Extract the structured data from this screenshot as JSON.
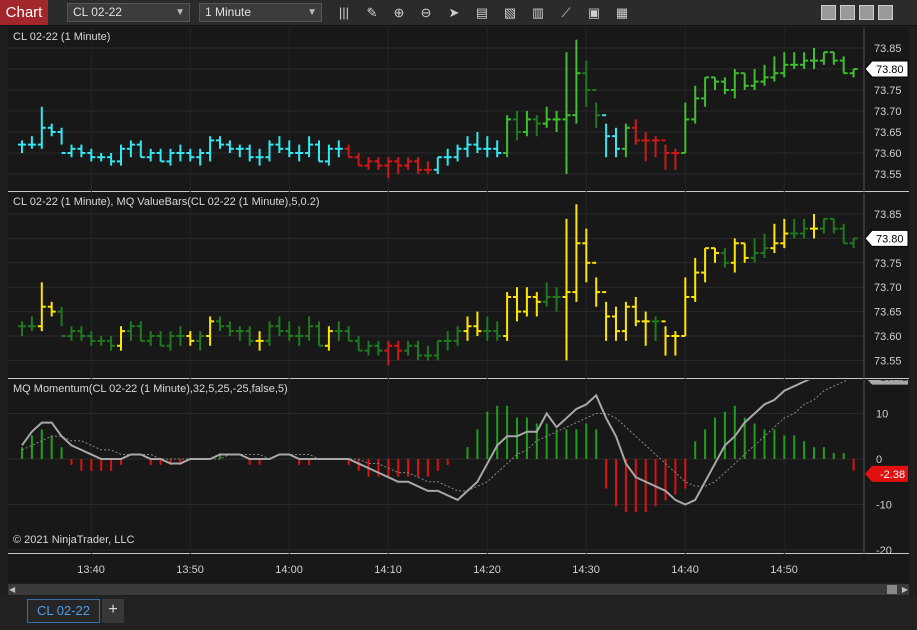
{
  "toolbar": {
    "chart_label": "Chart",
    "instrument": "CL 02-22",
    "interval": "1 Minute",
    "icons": [
      "bar-type-icon",
      "pencil-icon",
      "zoom-in-icon",
      "zoom-out-icon",
      "pointer-icon",
      "data-box-icon",
      "properties-icon",
      "indicators-icon",
      "strategies-icon",
      "chart-trader-icon",
      "templates-icon"
    ]
  },
  "panes": {
    "price": {
      "title": "CL 02-22 (1 Minute)",
      "ticks": [
        "73.85",
        "73.80",
        "73.75",
        "73.70",
        "73.65",
        "73.60",
        "73.55"
      ],
      "last_price": "73.80"
    },
    "valuebars": {
      "title": "CL 02-22 (1 Minute), MQ ValueBars(CL 02-22 (1 Minute),5,0.2)",
      "ticks": [
        "73.85",
        "73.80",
        "73.75",
        "73.70",
        "73.65",
        "73.60",
        "73.55"
      ],
      "last_price": "73.80"
    },
    "momentum": {
      "title": "MQ Momentum(CL 02-22 (1 Minute),32,5,25,-25,false,5)",
      "ticks": [
        "10",
        "0",
        "-10",
        "-20"
      ],
      "upper_level": "25",
      "lower_level": "-25",
      "line_value": "19.41",
      "histogram_value": "-2.38",
      "copyright": "© 2021 NinjaTrader, LLC"
    }
  },
  "time_axis": [
    "13:40",
    "13:50",
    "14:00",
    "14:10",
    "14:20",
    "14:30",
    "14:40",
    "14:50"
  ],
  "tabs": [
    {
      "label": "CL 02-22"
    }
  ],
  "add_tab_label": "+",
  "colors": {
    "up_cyan": "#33e8f2",
    "down_red": "#d01818",
    "green_light": "#3fbf2f",
    "green_dark": "#1f7a1f",
    "yellow": "#ffe600",
    "level_green": "#1ea01e",
    "level_red": "#e01010",
    "momentum_line": "#a8a8a8"
  },
  "chart_data": [
    {
      "type": "ohlc",
      "title": "CL 02-22 (1 Minute)",
      "x": [
        "13:33",
        "13:34",
        "13:35",
        "13:36",
        "13:37",
        "13:38",
        "13:39",
        "13:40",
        "13:41",
        "13:42",
        "13:43",
        "13:44",
        "13:45",
        "13:46",
        "13:47",
        "13:48",
        "13:49",
        "13:50",
        "13:51",
        "13:52",
        "13:53",
        "13:54",
        "13:55",
        "13:56",
        "13:57",
        "13:58",
        "13:59",
        "14:00",
        "14:01",
        "14:02",
        "14:03",
        "14:04",
        "14:05",
        "14:06",
        "14:07",
        "14:08",
        "14:09",
        "14:10",
        "14:11",
        "14:12",
        "14:13",
        "14:14",
        "14:15",
        "14:16",
        "14:17",
        "14:18",
        "14:19",
        "14:20",
        "14:21",
        "14:22",
        "14:23",
        "14:24",
        "14:25",
        "14:26",
        "14:27",
        "14:28",
        "14:29",
        "14:30",
        "14:31",
        "14:32",
        "14:33",
        "14:34",
        "14:35",
        "14:36",
        "14:37",
        "14:38",
        "14:39",
        "14:40",
        "14:41",
        "14:42",
        "14:43",
        "14:44",
        "14:45",
        "14:46",
        "14:47",
        "14:48",
        "14:49",
        "14:50",
        "14:51",
        "14:52",
        "14:53",
        "14:54",
        "14:55",
        "14:56",
        "14:57"
      ],
      "open": [
        73.62,
        73.62,
        73.62,
        73.66,
        73.65,
        73.6,
        73.61,
        73.6,
        73.59,
        73.59,
        73.58,
        73.61,
        73.62,
        73.59,
        73.6,
        73.58,
        73.6,
        73.6,
        73.59,
        73.6,
        73.63,
        73.62,
        73.61,
        73.61,
        73.59,
        73.59,
        73.62,
        73.61,
        73.6,
        73.6,
        73.62,
        73.58,
        73.61,
        73.61,
        73.59,
        73.57,
        73.58,
        73.57,
        73.58,
        73.57,
        73.58,
        73.56,
        73.56,
        73.59,
        73.59,
        73.61,
        73.62,
        73.61,
        73.61,
        73.6,
        73.68,
        73.65,
        73.68,
        73.67,
        73.68,
        73.68,
        73.69,
        73.79,
        73.75,
        73.69,
        73.64,
        73.61,
        73.66,
        73.63,
        73.63,
        73.63,
        73.6,
        73.6,
        73.68,
        73.73,
        73.78,
        73.77,
        73.75,
        73.79,
        73.76,
        73.77,
        73.78,
        73.79,
        73.81,
        73.81,
        73.82,
        73.82,
        73.84,
        73.82,
        73.79
      ],
      "high": [
        73.63,
        73.64,
        73.71,
        73.67,
        73.66,
        73.62,
        73.62,
        73.61,
        73.6,
        73.6,
        73.62,
        73.63,
        73.63,
        73.61,
        73.61,
        73.61,
        73.62,
        73.61,
        73.61,
        73.64,
        73.64,
        73.63,
        73.62,
        73.62,
        73.61,
        73.63,
        73.64,
        73.63,
        73.62,
        73.64,
        73.63,
        73.62,
        73.63,
        73.62,
        73.6,
        73.59,
        73.59,
        73.59,
        73.59,
        73.59,
        73.59,
        73.58,
        73.59,
        73.61,
        73.62,
        73.64,
        73.65,
        73.64,
        73.63,
        73.69,
        73.7,
        73.7,
        73.69,
        73.71,
        73.7,
        73.84,
        73.87,
        73.82,
        73.72,
        73.67,
        73.66,
        73.67,
        73.68,
        73.65,
        73.64,
        73.62,
        73.61,
        73.72,
        73.76,
        73.78,
        73.78,
        73.78,
        73.8,
        73.79,
        73.8,
        73.81,
        73.83,
        73.84,
        73.84,
        73.84,
        73.85,
        73.84,
        73.84,
        73.83,
        73.8
      ],
      "low": [
        73.6,
        73.61,
        73.61,
        73.64,
        73.62,
        73.59,
        73.59,
        73.58,
        73.58,
        73.57,
        73.57,
        73.59,
        73.59,
        73.58,
        73.58,
        73.57,
        73.58,
        73.58,
        73.57,
        73.58,
        73.61,
        73.6,
        73.59,
        73.58,
        73.57,
        73.58,
        73.6,
        73.59,
        73.58,
        73.59,
        73.58,
        73.57,
        73.59,
        73.59,
        73.57,
        73.56,
        73.56,
        73.54,
        73.55,
        73.56,
        73.55,
        73.55,
        73.55,
        73.57,
        73.58,
        73.59,
        73.6,
        73.59,
        73.59,
        73.59,
        73.63,
        73.64,
        73.64,
        73.66,
        73.65,
        73.55,
        73.67,
        73.71,
        73.66,
        73.59,
        73.59,
        73.59,
        73.62,
        73.58,
        73.59,
        73.56,
        73.56,
        73.6,
        73.67,
        73.71,
        73.75,
        73.74,
        73.73,
        73.75,
        73.75,
        73.76,
        73.77,
        73.78,
        73.8,
        73.8,
        73.8,
        73.81,
        73.81,
        73.79,
        73.78
      ],
      "close": [
        73.62,
        73.62,
        73.66,
        73.65,
        73.6,
        73.61,
        73.6,
        73.59,
        73.59,
        73.58,
        73.61,
        73.62,
        73.59,
        73.6,
        73.58,
        73.6,
        73.6,
        73.59,
        73.6,
        73.63,
        73.62,
        73.61,
        73.61,
        73.59,
        73.59,
        73.62,
        73.61,
        73.6,
        73.6,
        73.62,
        73.58,
        73.61,
        73.61,
        73.59,
        73.57,
        73.58,
        73.57,
        73.58,
        73.57,
        73.58,
        73.56,
        73.56,
        73.59,
        73.59,
        73.61,
        73.62,
        73.61,
        73.61,
        73.6,
        73.68,
        73.65,
        73.68,
        73.67,
        73.68,
        73.68,
        73.69,
        73.79,
        73.75,
        73.69,
        73.64,
        73.61,
        73.66,
        73.63,
        73.63,
        73.63,
        73.6,
        73.6,
        73.68,
        73.73,
        73.78,
        73.77,
        73.75,
        73.79,
        73.76,
        73.77,
        73.78,
        73.79,
        73.81,
        73.81,
        73.82,
        73.82,
        73.84,
        73.82,
        73.79,
        73.8
      ]
    },
    {
      "type": "line+histogram",
      "title": "MQ Momentum(CL 02-22 (1 Minute),32,5,25,-25,false,5)",
      "x": [
        "13:33",
        "13:34",
        "13:35",
        "13:36",
        "13:37",
        "13:38",
        "13:39",
        "13:40",
        "13:41",
        "13:42",
        "13:43",
        "13:44",
        "13:45",
        "13:46",
        "13:47",
        "13:48",
        "13:49",
        "13:50",
        "13:51",
        "13:52",
        "13:53",
        "13:54",
        "13:55",
        "13:56",
        "13:57",
        "13:58",
        "13:59",
        "14:00",
        "14:01",
        "14:02",
        "14:03",
        "14:04",
        "14:05",
        "14:06",
        "14:07",
        "14:08",
        "14:09",
        "14:10",
        "14:11",
        "14:12",
        "14:13",
        "14:14",
        "14:15",
        "14:16",
        "14:17",
        "14:18",
        "14:19",
        "14:20",
        "14:21",
        "14:22",
        "14:23",
        "14:24",
        "14:25",
        "14:26",
        "14:27",
        "14:28",
        "14:29",
        "14:30",
        "14:31",
        "14:32",
        "14:33",
        "14:34",
        "14:35",
        "14:36",
        "14:37",
        "14:38",
        "14:39",
        "14:40",
        "14:41",
        "14:42",
        "14:43",
        "14:44",
        "14:45",
        "14:46",
        "14:47",
        "14:48",
        "14:49",
        "14:50",
        "14:51",
        "14:52",
        "14:53",
        "14:54",
        "14:55",
        "14:56",
        "14:57"
      ],
      "momentum": [
        3,
        6,
        8,
        8,
        5,
        3,
        2,
        1,
        0,
        0,
        0,
        1,
        1,
        0,
        0,
        -1,
        -1,
        0,
        0,
        0,
        1,
        1,
        1,
        0,
        0,
        0,
        1,
        1,
        0,
        0,
        0,
        0,
        0,
        0,
        -1,
        -2,
        -3,
        -4,
        -5,
        -5,
        -6,
        -7,
        -7,
        -8,
        -9,
        -7,
        -5,
        -1,
        3,
        5,
        5,
        6,
        6,
        10,
        7,
        9,
        11,
        12,
        14,
        9,
        5,
        -1,
        -4,
        -5,
        -6,
        -7,
        -9,
        -10,
        -9,
        -5,
        -1,
        3,
        5,
        8,
        10,
        12,
        13,
        15,
        16,
        17,
        18,
        19,
        21,
        21,
        19
      ],
      "signal": [
        2,
        3,
        4,
        5,
        5,
        4,
        4,
        3,
        2,
        2,
        1,
        1,
        1,
        1,
        0,
        0,
        0,
        0,
        0,
        0,
        0,
        1,
        1,
        1,
        1,
        0,
        1,
        1,
        1,
        1,
        0,
        0,
        0,
        0,
        0,
        -1,
        -1,
        -2,
        -3,
        -3,
        -4,
        -5,
        -5,
        -6,
        -7,
        -7,
        -6,
        -5,
        -3,
        -1,
        1,
        2,
        4,
        5,
        6,
        7,
        8,
        9,
        10,
        10,
        9,
        7,
        5,
        3,
        1,
        -1,
        -3,
        -5,
        -6,
        -6,
        -5,
        -3,
        -1,
        1,
        3,
        5,
        7,
        9,
        10,
        12,
        13,
        15,
        16,
        17,
        18
      ],
      "histogram": [
        2,
        4,
        5,
        4,
        2,
        -1,
        -2,
        -2,
        -2,
        -2,
        -1,
        0,
        0,
        -1,
        -1,
        -1,
        -1,
        0,
        0,
        0,
        1,
        0,
        0,
        -1,
        -1,
        0,
        0,
        0,
        -1,
        -1,
        0,
        0,
        0,
        -1,
        -2,
        -3,
        -3,
        -3,
        -3,
        -3,
        -3,
        -3,
        -2,
        -1,
        0,
        2,
        5,
        8,
        9,
        9,
        7,
        7,
        6,
        6,
        5,
        5,
        5,
        6,
        5,
        -5,
        -8,
        -9,
        -9,
        -9,
        -8,
        -7,
        -6,
        -5,
        3,
        5,
        7,
        8,
        9,
        7,
        6,
        5,
        5,
        4,
        4,
        3,
        2,
        2,
        1,
        1,
        -2
      ],
      "levels": [
        25,
        -25
      ],
      "ylim": [
        -25,
        25
      ]
    }
  ]
}
